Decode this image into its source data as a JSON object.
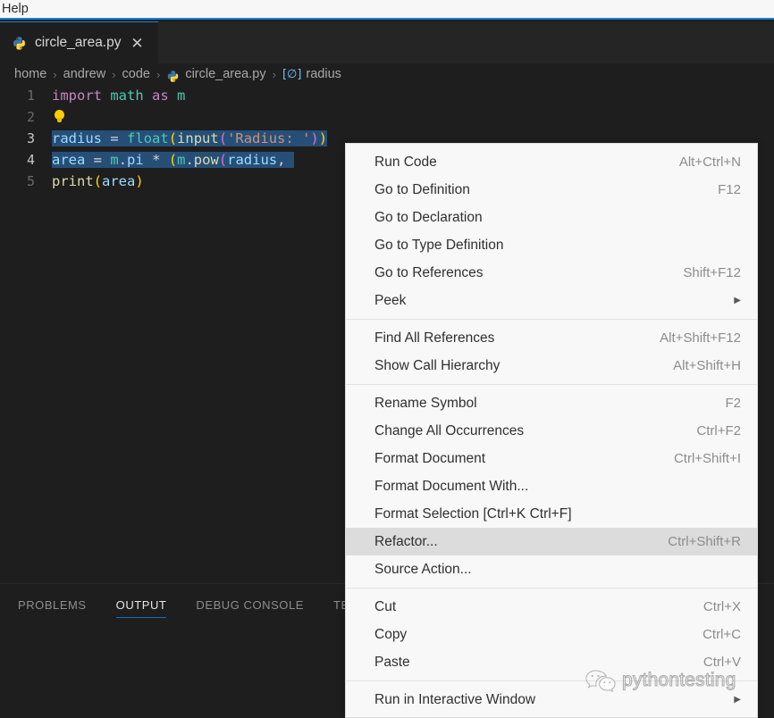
{
  "menubar": {
    "items": [
      {
        "label": "Help"
      }
    ]
  },
  "tab": {
    "label": "circle_area.py",
    "icon": "python-icon",
    "close_icon": "close-icon"
  },
  "breadcrumb": {
    "segments": [
      "home",
      "andrew",
      "code",
      "circle_area.py",
      "radius"
    ],
    "separator": "›",
    "file_icon": "python-icon",
    "symbol_icon": "variable-icon"
  },
  "editor": {
    "lines": [
      {
        "number": "1",
        "active": false
      },
      {
        "number": "2",
        "active": false
      },
      {
        "number": "3",
        "active": true
      },
      {
        "number": "4",
        "active": true
      },
      {
        "number": "5",
        "active": false
      }
    ],
    "code": {
      "l1_import": "import",
      "l1_math": "math",
      "l1_as": "as",
      "l1_m": "m",
      "l2_icon": "lightbulb-icon",
      "l3_radius": "radius",
      "l3_eq": "=",
      "l3_float": "float",
      "l3_p1": "(",
      "l3_input": "input",
      "l3_p2": "(",
      "l3_str": "'Radius: '",
      "l3_p3": ")",
      "l3_p4": ")",
      "l4_area": "area",
      "l4_eq": "=",
      "l4_m": "m",
      "l4_dot1": ".",
      "l4_pi": "pi",
      "l4_star": "*",
      "l4_p1": "(",
      "l4_m2": "m",
      "l4_dot2": ".",
      "l4_pow": "pow",
      "l4_p2": "(",
      "l4_radius": "radius",
      "l4_comma": ",",
      "l5_print": "print",
      "l5_p1": "(",
      "l5_area": "area",
      "l5_p2": ")"
    }
  },
  "panel": {
    "tabs": [
      {
        "label": "PROBLEMS",
        "active": false
      },
      {
        "label": "OUTPUT",
        "active": true
      },
      {
        "label": "DEBUG CONSOLE",
        "active": false
      },
      {
        "label": "TERMINAL",
        "active": false
      }
    ]
  },
  "context_menu": {
    "groups": [
      {
        "items": [
          {
            "label": "Run Code",
            "key": "Alt+Ctrl+N",
            "submenu": false,
            "highlight": false
          },
          {
            "label": "Go to Definition",
            "key": "F12",
            "submenu": false,
            "highlight": false
          },
          {
            "label": "Go to Declaration",
            "key": "",
            "submenu": false,
            "highlight": false
          },
          {
            "label": "Go to Type Definition",
            "key": "",
            "submenu": false,
            "highlight": false
          },
          {
            "label": "Go to References",
            "key": "Shift+F12",
            "submenu": false,
            "highlight": false
          },
          {
            "label": "Peek",
            "key": "",
            "submenu": true,
            "highlight": false
          }
        ]
      },
      {
        "items": [
          {
            "label": "Find All References",
            "key": "Alt+Shift+F12",
            "submenu": false,
            "highlight": false
          },
          {
            "label": "Show Call Hierarchy",
            "key": "Alt+Shift+H",
            "submenu": false,
            "highlight": false
          }
        ]
      },
      {
        "items": [
          {
            "label": "Rename Symbol",
            "key": "F2",
            "submenu": false,
            "highlight": false
          },
          {
            "label": "Change All Occurrences",
            "key": "Ctrl+F2",
            "submenu": false,
            "highlight": false
          },
          {
            "label": "Format Document",
            "key": "Ctrl+Shift+I",
            "submenu": false,
            "highlight": false
          },
          {
            "label": "Format Document With...",
            "key": "",
            "submenu": false,
            "highlight": false
          },
          {
            "label": "Format Selection [Ctrl+K Ctrl+F]",
            "key": "",
            "submenu": false,
            "highlight": false
          },
          {
            "label": "Refactor...",
            "key": "Ctrl+Shift+R",
            "submenu": false,
            "highlight": true
          },
          {
            "label": "Source Action...",
            "key": "",
            "submenu": false,
            "highlight": false
          }
        ]
      },
      {
        "items": [
          {
            "label": "Cut",
            "key": "Ctrl+X",
            "submenu": false,
            "highlight": false
          },
          {
            "label": "Copy",
            "key": "Ctrl+C",
            "submenu": false,
            "highlight": false
          },
          {
            "label": "Paste",
            "key": "Ctrl+V",
            "submenu": false,
            "highlight": false
          }
        ]
      },
      {
        "items": [
          {
            "label": "Run in Interactive Window",
            "key": "",
            "submenu": true,
            "highlight": false
          }
        ]
      }
    ]
  },
  "watermark": {
    "text": "pythontesting",
    "logo": "wechat-icon"
  },
  "colors": {
    "accent": "#1c7fd6",
    "editor_bg": "#1e1e1e",
    "menu_bg": "#f8f8f8",
    "selection": "#264f78",
    "highlight": "#dcdcdc"
  }
}
